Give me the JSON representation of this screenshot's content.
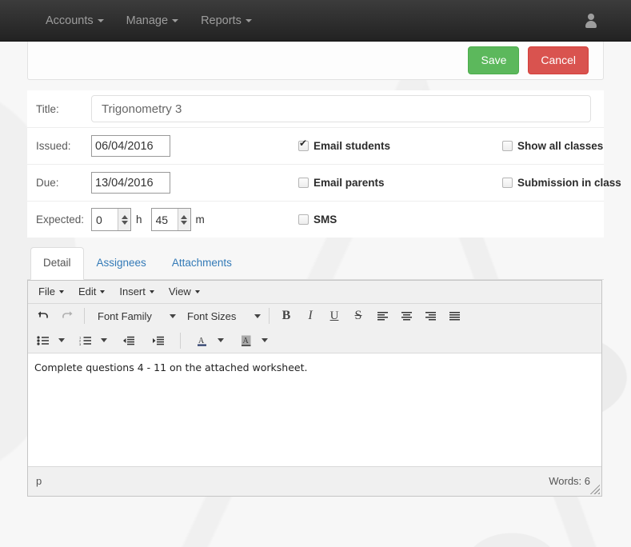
{
  "navbar": {
    "items": [
      {
        "label": "Accounts",
        "name": "nav-accounts"
      },
      {
        "label": "Manage",
        "name": "nav-manage"
      },
      {
        "label": "Reports",
        "name": "nav-reports"
      }
    ],
    "user_icon": "user-icon",
    "background": "#2b2b2b"
  },
  "actions": {
    "save_label": "Save",
    "cancel_label": "Cancel",
    "save_color": "#5cb85c",
    "cancel_color": "#d9534f"
  },
  "form": {
    "title": {
      "label": "Title:",
      "value": "Trigonometry 3",
      "placeholder": "Title"
    },
    "issued": {
      "label": "Issued:",
      "value": "06/04/2016"
    },
    "due": {
      "label": "Due:",
      "value": "13/04/2016"
    },
    "expected": {
      "label": "Expected:",
      "hours_value": "0",
      "hours_unit": "h",
      "minutes_value": "45",
      "minutes_unit": "m"
    },
    "checkboxes": {
      "email_students": {
        "label": "Email students",
        "checked": true
      },
      "show_all_classes": {
        "label": "Show all classes",
        "checked": false
      },
      "email_parents": {
        "label": "Email parents",
        "checked": false
      },
      "submission_in_class": {
        "label": "Submission in class",
        "checked": false
      },
      "sms": {
        "label": "SMS",
        "checked": false
      }
    }
  },
  "tabs": [
    {
      "label": "Detail",
      "active": true
    },
    {
      "label": "Assignees",
      "active": false
    },
    {
      "label": "Attachments",
      "active": false
    }
  ],
  "editor": {
    "menubar": [
      "File",
      "Edit",
      "Insert",
      "View"
    ],
    "toolbar_row1": {
      "undo": "undo-icon",
      "redo": "redo-icon",
      "font_family_label": "Font Family",
      "font_sizes_label": "Font Sizes",
      "bold": "B",
      "italic": "I",
      "underline": "U",
      "strikethrough": "S",
      "align_left": "align-left-icon",
      "align_center": "align-center-icon",
      "align_right": "align-right-icon",
      "align_justify": "align-justify-icon"
    },
    "toolbar_row2": {
      "bullet_list": "bullet-list-icon",
      "numbered_list": "numbered-list-icon",
      "outdent": "outdent-icon",
      "indent": "indent-icon",
      "text_color": "text-color-icon",
      "background_color": "background-color-icon"
    },
    "content": "Complete questions 4 - 11 on the attached worksheet.",
    "statusbar": {
      "path": "p",
      "words": "Words: 6"
    }
  }
}
